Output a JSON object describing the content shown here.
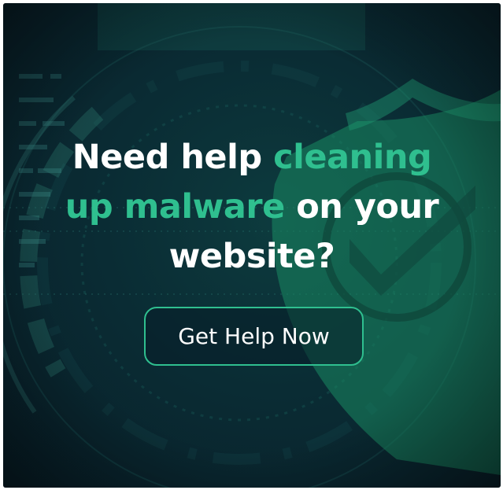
{
  "headline": {
    "line1_white": "Need help ",
    "line1_green": "cleaning",
    "line2_green": "up malware",
    "line2_white": " on your",
    "line3_white": "website?"
  },
  "cta": {
    "label": "Get Help Now"
  },
  "colors": {
    "accent": "#2fbf8f",
    "background": "#0a2c34",
    "text": "#ffffff"
  },
  "icons": [
    "shield-check-icon"
  ]
}
